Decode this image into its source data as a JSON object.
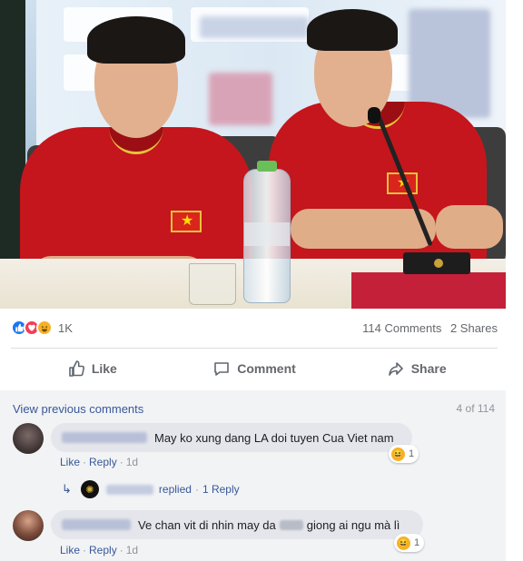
{
  "post": {
    "reactions": {
      "count": "1K",
      "icons": [
        "like-icon",
        "love-icon",
        "haha-icon"
      ]
    },
    "comments_count": "114 Comments",
    "shares_count": "2 Shares",
    "actions": {
      "like": "Like",
      "comment": "Comment",
      "share": "Share"
    }
  },
  "comments_section": {
    "view_previous": "View previous comments",
    "page_count": "4 of 114",
    "items": [
      {
        "text": "May ko xung dang LA doi tuyen Cua Viet nam",
        "like": "Like",
        "reply": "Reply",
        "time": "1d",
        "reaction_count": "1",
        "reaction_icon": "haha-icon",
        "reply_preview": {
          "replied": "replied",
          "reply_count": "1 Reply"
        }
      },
      {
        "text_before": "Ve chan vit di nhin may da",
        "text_after": "giong ai ngu mà lì",
        "like": "Like",
        "reply": "Reply",
        "time": "1d",
        "reaction_count": "1",
        "reaction_icon": "haha-icon"
      }
    ]
  },
  "colors": {
    "link": "#385898",
    "jersey_red": "#c4161c",
    "like_blue": "#1877f2"
  }
}
